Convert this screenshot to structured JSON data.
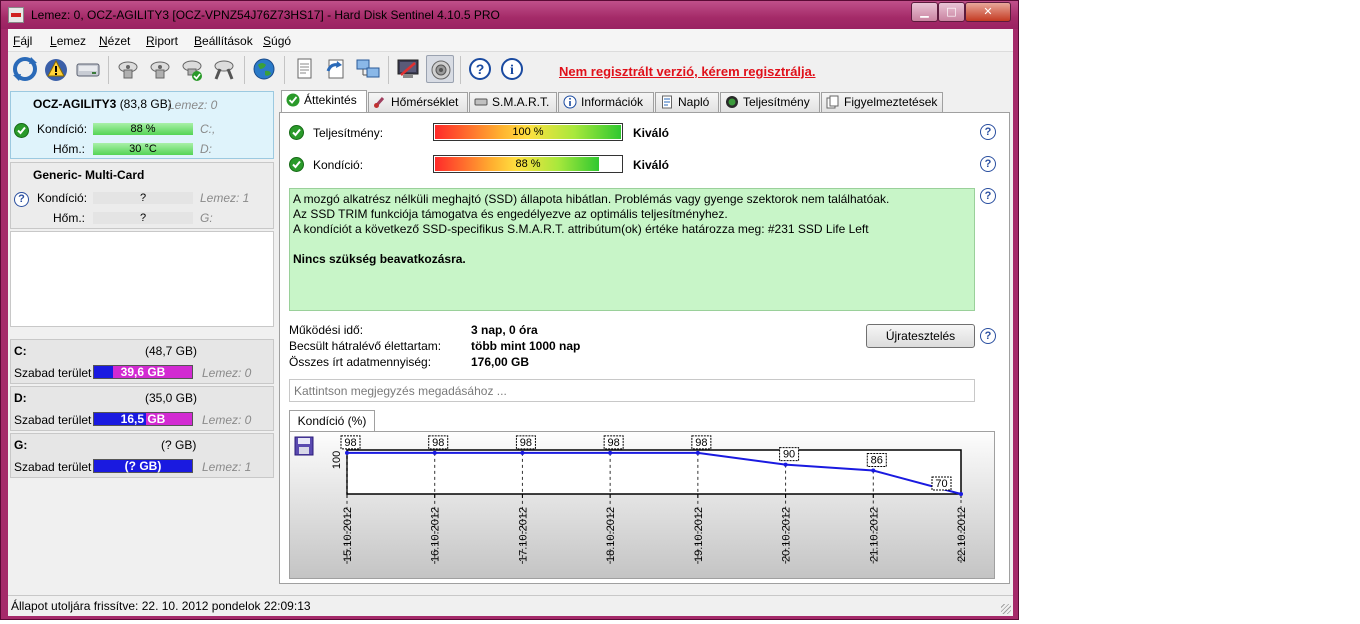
{
  "window": {
    "title": "Lemez: 0, OCZ-AGILITY3 [OCZ-VPNZ54J76Z73HS17]  -  Hard Disk Sentinel 4.10.5 PRO",
    "minimize_glyph": "▁",
    "maximize_glyph": "□",
    "close_glyph": "✕"
  },
  "menu": [
    "Fájl",
    "Lemez",
    "Nézet",
    "Riport",
    "Beállítások",
    "Súgó"
  ],
  "toolbar": {
    "icons": [
      "refresh-icon",
      "warning-icon",
      "disk-icon",
      "disk-test-icon",
      "disk-test-icon",
      "disk-test-check-icon",
      "disk-test-tool-icon",
      "globe-icon",
      "report-icon",
      "send-report-icon",
      "network-icon",
      "settings-icon",
      "sound-icon",
      "help-icon",
      "info-icon"
    ],
    "register_text": "Nem regisztrált verzió, kérem regisztrálja."
  },
  "disks": [
    {
      "name": "OCZ-AGILITY3",
      "size": "(83,8 GB)",
      "disk_label": "Lemez: 0",
      "condition_label": "Kondíció:",
      "condition_value": "88 %",
      "condition_percent": 88,
      "drive_letter": "C:,",
      "temp_label": "Hőm.:",
      "temp_value": "30 °C",
      "temp_drive": "D:"
    },
    {
      "name": "Generic- Multi-Card",
      "condition_label": "Kondíció:",
      "condition_value": "?",
      "disk_label": "Lemez: 1",
      "temp_label": "Hőm.:",
      "temp_value": "?",
      "temp_drive": "G:"
    }
  ],
  "partitions": [
    {
      "letter": "C:",
      "size": "(48,7 GB)",
      "free_label": "Szabad terület",
      "free_value": "39,6 GB",
      "free_fraction": 0.81,
      "disk_label": "Lemez: 0"
    },
    {
      "letter": "D:",
      "size": "(35,0 GB)",
      "free_label": "Szabad terület",
      "free_value": "16,5 GB",
      "free_fraction": 0.47,
      "disk_label": "Lemez: 0"
    },
    {
      "letter": "G:",
      "size": "(? GB)",
      "free_label": "Szabad terület",
      "free_value": "(? GB)",
      "free_fraction": 0,
      "disk_label": "Lemez: 1"
    }
  ],
  "tabs": [
    "Áttekintés",
    "Hőmérséklet",
    "S.M.A.R.T.",
    "Információk",
    "Napló",
    "Teljesítmény",
    "Figyelmeztetések"
  ],
  "overview": {
    "performance_label": "Teljesítmény:",
    "performance_value": "100 %",
    "performance_percent": 100,
    "performance_rating": "Kiváló",
    "condition_label": "Kondíció:",
    "condition_value": "88 %",
    "condition_percent": 88,
    "condition_rating": "Kiváló",
    "message_lines": [
      "A mozgó alkatrész nélküli meghajtó (SSD) állapota hibátlan. Problémás vagy gyenge szektorok nem találhatóak.",
      "Az SSD TRIM funkciója támogatva és engedélyezve az optimális teljesítményhez.",
      "A kondíciót a következő SSD-specifikus S.M.A.R.T. attribútum(ok) értéke határozza meg:  #231 SSD Life Left"
    ],
    "message_bold": "Nincs szükség beavatkozásra.",
    "uptime_label": "Működési idő:",
    "uptime_value": "3 nap, 0 óra",
    "lifetime_label": "Becsült hátralévő élettartam:",
    "lifetime_value": "több mint 1000 nap",
    "written_label": "Összes írt adatmennyiség:",
    "written_value": "176,00 GB",
    "retest_button": "Újratesztelés",
    "note_placeholder": "Kattintson megjegyzés megadásához ...",
    "help_glyph": "?"
  },
  "chart_tab": "Kondíció  (%)",
  "chart_data": {
    "type": "line",
    "x": [
      "15.10.2012",
      "16.10.2012",
      "17.10.2012",
      "18.10.2012",
      "19.10.2012",
      "20.10.2012",
      "21.10.2012",
      "22.10.2012"
    ],
    "series": [
      {
        "values": [
          98,
          98,
          98,
          98,
          98,
          90,
          86,
          70
        ]
      }
    ],
    "y_tick": "100",
    "ylim": [
      70,
      100
    ],
    "color": "#1a1ae0"
  },
  "statusbar": "Állapot utoljára frissítve: 22. 10. 2012 pondelok 22:09:13"
}
